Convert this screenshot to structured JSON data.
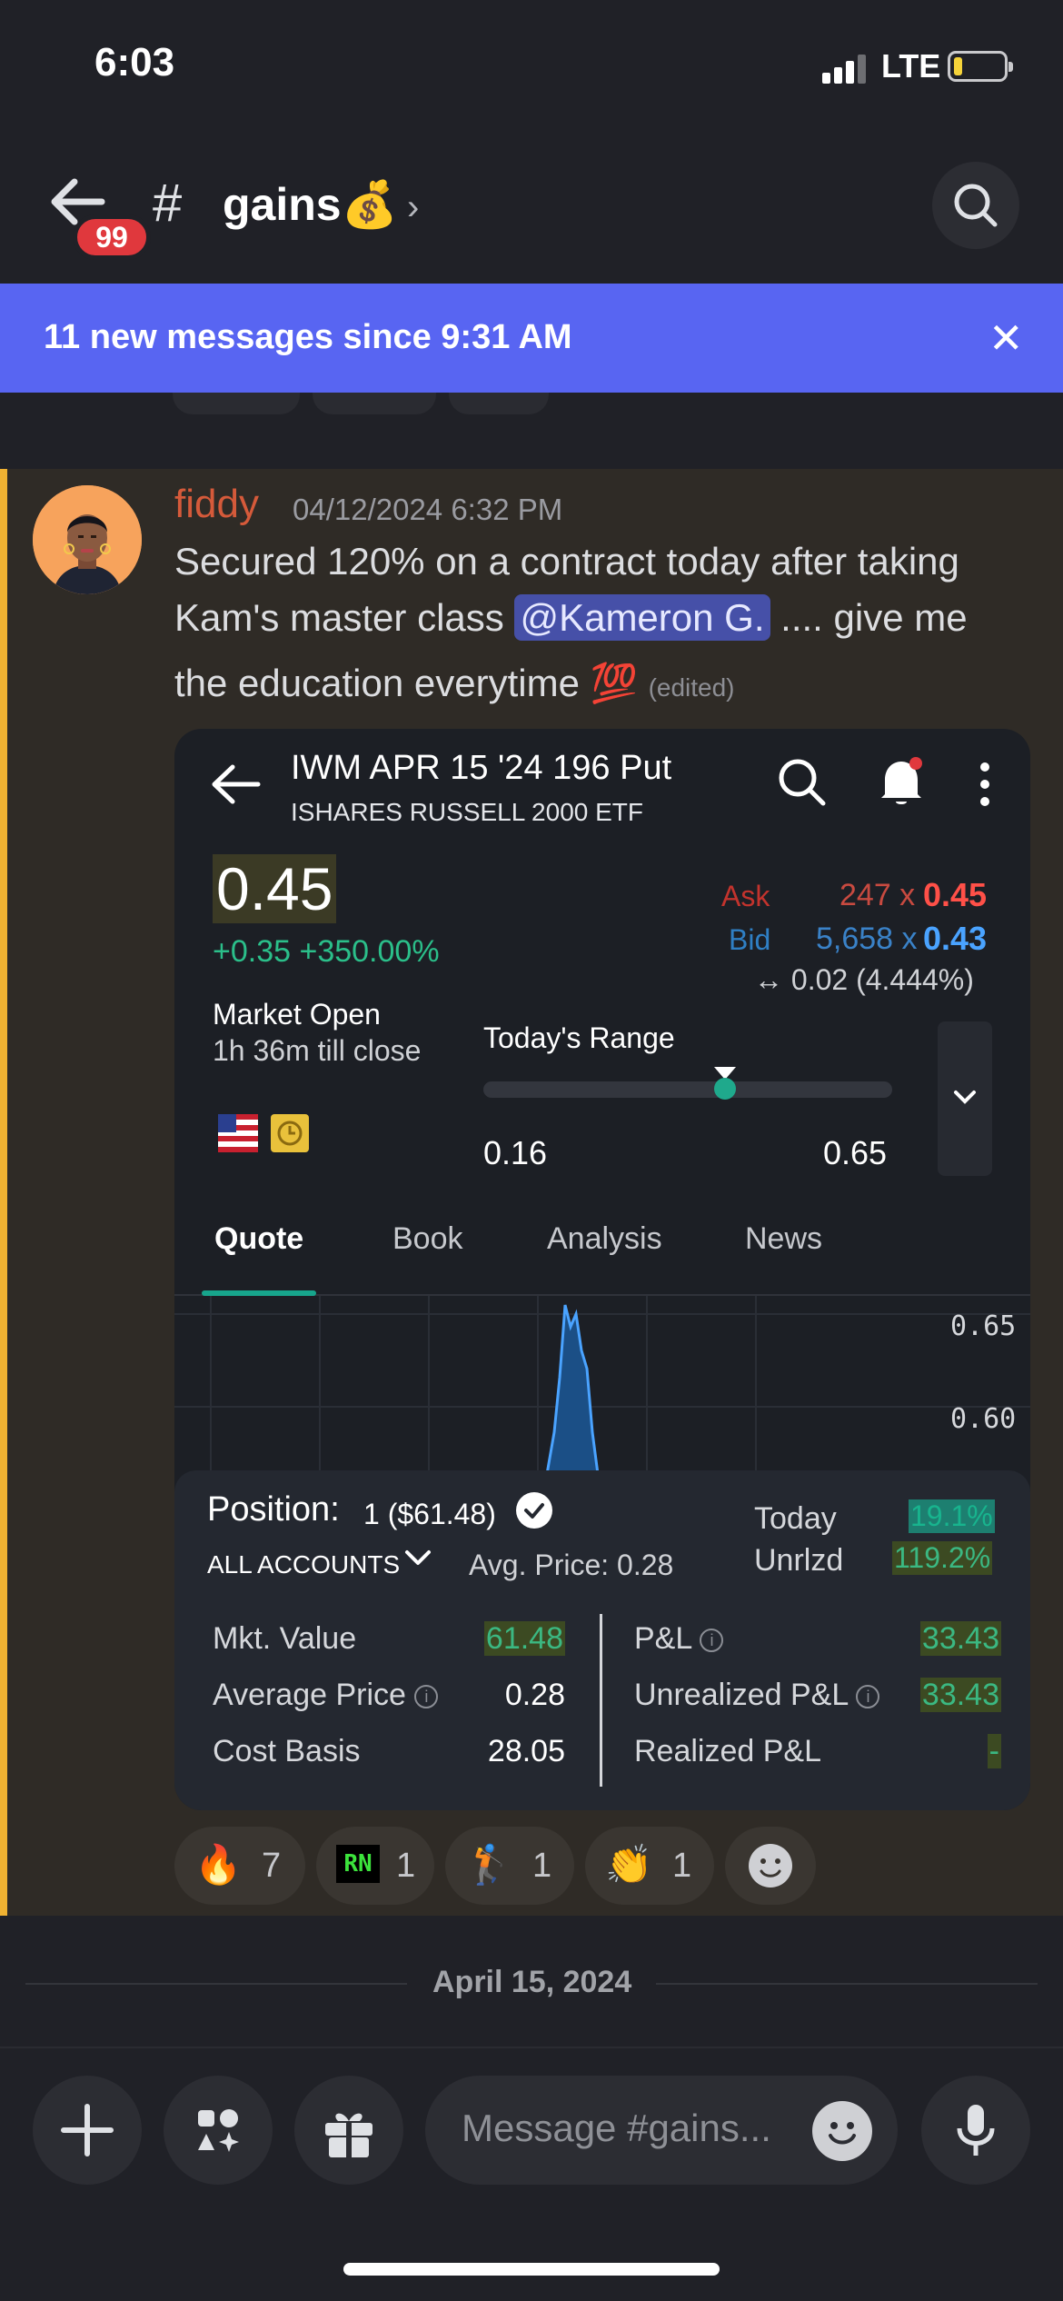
{
  "status_bar": {
    "time": "6:03",
    "network": "LTE"
  },
  "header": {
    "unread_badge": "99",
    "hash": "#",
    "channel_name": "gains💰",
    "chevron": "›"
  },
  "banner": {
    "text": "11 new messages since 9:31 AM",
    "close": "✕"
  },
  "message": {
    "author": "fiddy",
    "timestamp": "04/12/2024 6:32 PM",
    "line1": "Secured 120% on a contract today after taking",
    "line2_pre": "Kam's master class ",
    "mention": "@Kameron G.",
    "line2_post": " .... give me",
    "line3": "the education everytime 💯",
    "edited": "(edited)"
  },
  "screenshot": {
    "title": "IWM APR 15 '24 196 Put",
    "subtitle": "ISHARES RUSSELL 2000 ETF",
    "price": "0.45",
    "change": "+0.35  +350.00%",
    "ask_label": "Ask",
    "ask_size": "247 x",
    "ask_price": "0.45",
    "bid_label": "Bid",
    "bid_size": "5,658 x",
    "bid_price": "0.43",
    "spread": "↔ 0.02 (4.444%)",
    "market_status": "Market Open",
    "market_sub": "1h 36m till close",
    "range_label": "Today's Range",
    "range_low": "0.16",
    "range_high": "0.65",
    "range_position": 0.59,
    "tabs": [
      "Quote",
      "Book",
      "Analysis",
      "News"
    ],
    "axis_top": "0.65",
    "axis_mid": "0.60",
    "position_label": "Position:",
    "position_value": "1 ($61.48)",
    "accounts": "ALL ACCOUNTS",
    "avg_price": "Avg. Price: 0.28",
    "today_label": "Today",
    "today_value": "19.1%",
    "unrlzd_label": "Unrlzd",
    "unrlzd_value": "119.2%",
    "left_rows": [
      {
        "label": "Mkt. Value",
        "value": "61.48"
      },
      {
        "label": "Average Price",
        "value": "0.28"
      },
      {
        "label": "Cost Basis",
        "value": "28.05"
      }
    ],
    "right_rows": [
      {
        "label": "P&L",
        "value": "33.43"
      },
      {
        "label": "Unrealized P&L",
        "value": "33.43"
      },
      {
        "label": "Realized P&L",
        "value": "-"
      }
    ]
  },
  "reactions": [
    {
      "emoji": "🔥",
      "count": "7"
    },
    {
      "emoji": "RN",
      "count": "1"
    },
    {
      "emoji": "🏌",
      "count": "1"
    },
    {
      "emoji": "👏",
      "count": "1"
    }
  ],
  "date_divider": "April 15, 2024",
  "composer": {
    "placeholder": "Message #gains..."
  },
  "colors": {
    "accent": "#5865f2",
    "highlight_bar": "#f0b232",
    "author": "#d55a3a",
    "badge": "#e0383d"
  }
}
